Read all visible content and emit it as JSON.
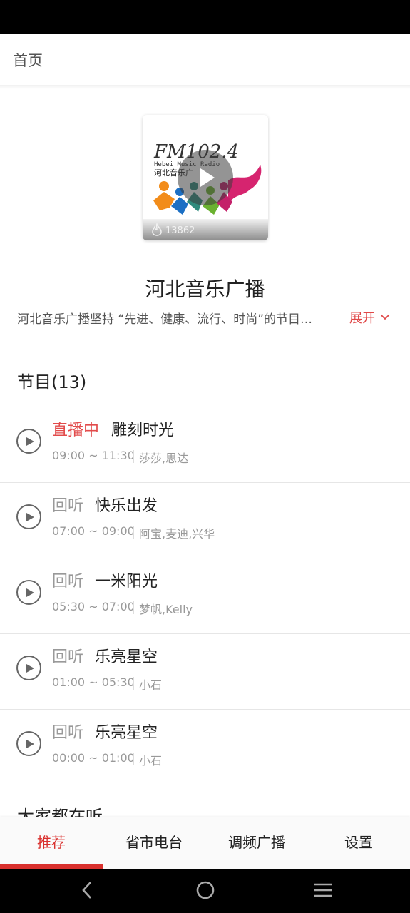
{
  "header": {
    "title": "首页"
  },
  "station": {
    "cover_logo_text": "FM102.4 Hebei Music Radio 河北音乐广播",
    "listen_count": "13862",
    "name": "河北音乐广播",
    "description": "河北音乐广播坚持 “先进、健康、流行、时尚”的节目…",
    "expand_label": "展开"
  },
  "programs": {
    "section_title": "节目(13)",
    "items": [
      {
        "status": "直播中",
        "name": "雕刻时光",
        "time": "09:00 ~ 11:30",
        "hosts": "莎莎,思达",
        "live": true
      },
      {
        "status": "回听",
        "name": "快乐出发",
        "time": "07:00 ~ 09:00",
        "hosts": "阿宝,麦迪,兴华",
        "live": false
      },
      {
        "status": "回听",
        "name": "一米阳光",
        "time": "05:30 ~ 07:00",
        "hosts": "梦帆,Kelly",
        "live": false
      },
      {
        "status": "回听",
        "name": "乐亮星空",
        "time": "01:00 ~ 05:30",
        "hosts": "小石",
        "live": false
      },
      {
        "status": "回听",
        "name": "乐亮星空",
        "time": "00:00 ~ 01:00",
        "hosts": "小石",
        "live": false
      }
    ]
  },
  "everyone_listening": {
    "title": "大家都在听"
  },
  "tabs": [
    {
      "label": "推荐",
      "active": true
    },
    {
      "label": "省市电台",
      "active": false
    },
    {
      "label": "调频广播",
      "active": false
    },
    {
      "label": "设置",
      "active": false
    }
  ],
  "colors": {
    "accent": "#d9302d",
    "live": "#e24b4b",
    "muted": "#999999"
  },
  "icons": {
    "back": "back-triangle-icon",
    "home": "home-circle-icon",
    "menu": "menu-lines-icon",
    "play": "play-icon",
    "fire": "fire-icon",
    "chevron": "chevron-down-icon"
  }
}
